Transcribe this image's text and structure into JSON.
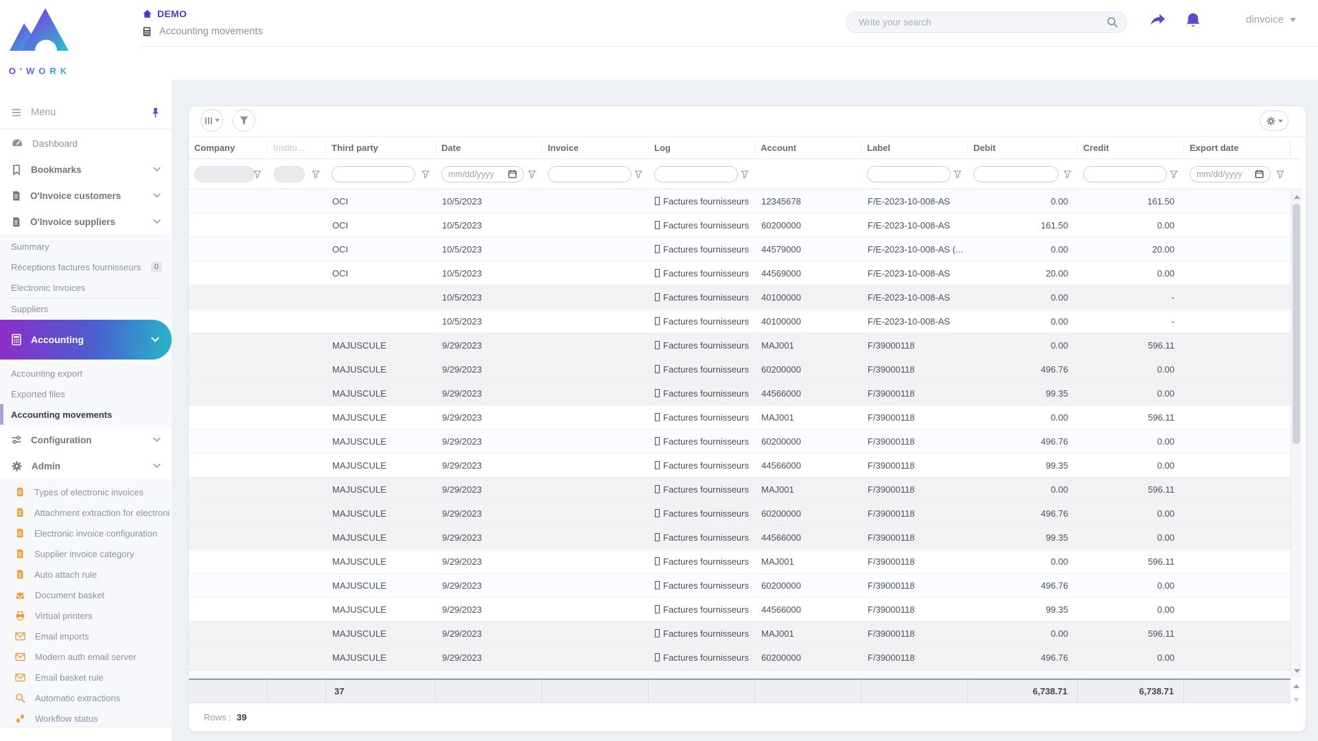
{
  "header": {
    "breadcrumb_root": "DEMO",
    "breadcrumb_page": "Accounting movements",
    "search_placeholder": "Write your search",
    "user": "dinvoice"
  },
  "sidebar": {
    "logo_text": "O'WORK",
    "menu_label": "Menu",
    "items": [
      {
        "label": "Dashboard"
      },
      {
        "label": "Bookmarks"
      },
      {
        "label": "O'Invoice customers"
      },
      {
        "label": "O'Invoice suppliers"
      }
    ],
    "suppliers_submenu": [
      {
        "label": "Summary"
      },
      {
        "label": "Réceptions factures fournisseurs",
        "badge": "0"
      },
      {
        "label": "Electronic Invoices"
      },
      {
        "label": "Suppliers"
      }
    ],
    "accounting_label": "Accounting",
    "accounting_submenu": [
      {
        "label": "Accounting export"
      },
      {
        "label": "Exported files"
      },
      {
        "label": "Accounting movements",
        "active": true
      }
    ],
    "configuration_label": "Configuration",
    "admin_label": "Admin",
    "admin_submenu": [
      {
        "label": "Types of electronic invoices"
      },
      {
        "label": "Attachment extraction for electroni"
      },
      {
        "label": "Electronic invoice configuration"
      },
      {
        "label": "Supplier invoice category"
      },
      {
        "label": "Auto attach rule"
      },
      {
        "label": "Document basket"
      },
      {
        "label": "Virtual printers"
      },
      {
        "label": "Email imports"
      },
      {
        "label": "Modern auth email server"
      },
      {
        "label": "Email basket rule"
      },
      {
        "label": "Automatic extractions"
      },
      {
        "label": "Workflow status"
      }
    ]
  },
  "grid": {
    "columns": [
      {
        "label": "Company"
      },
      {
        "label": "Institu..."
      },
      {
        "label": "Third party"
      },
      {
        "label": "Date"
      },
      {
        "label": "Invoice"
      },
      {
        "label": "Log"
      },
      {
        "label": "Account"
      },
      {
        "label": "Label"
      },
      {
        "label": "Debit"
      },
      {
        "label": "Credit"
      },
      {
        "label": "Export date"
      }
    ],
    "date_placeholder": "mm/dd/yyyy",
    "rows": [
      {
        "third_party": "OCI",
        "date": "10/5/2023",
        "log": "Factures fournisseurs",
        "account": "12345678",
        "label": "F/E-2023-10-008-AS",
        "debit": "0.00",
        "credit": "161.50",
        "shaded": false
      },
      {
        "third_party": "OCI",
        "date": "10/5/2023",
        "log": "Factures fournisseurs",
        "account": "60200000",
        "label": "F/E-2023-10-008-AS",
        "debit": "161.50",
        "credit": "0.00",
        "shaded": false
      },
      {
        "third_party": "OCI",
        "date": "10/5/2023",
        "log": "Factures fournisseurs",
        "account": "44579000",
        "label": "F/E-2023-10-008-AS (...",
        "debit": "0.00",
        "credit": "20.00",
        "shaded": false
      },
      {
        "third_party": "OCI",
        "date": "10/5/2023",
        "log": "Factures fournisseurs",
        "account": "44569000",
        "label": "F/E-2023-10-008-AS",
        "debit": "20.00",
        "credit": "0.00",
        "shaded": false
      },
      {
        "third_party": "",
        "date": "10/5/2023",
        "log": "Factures fournisseurs",
        "account": "40100000",
        "label": "F/E-2023-10-008-AS",
        "debit": "0.00",
        "credit": "-",
        "shaded": true
      },
      {
        "third_party": "",
        "date": "10/5/2023",
        "log": "Factures fournisseurs",
        "account": "40100000",
        "label": "F/E-2023-10-008-AS",
        "debit": "0.00",
        "credit": "-",
        "shaded": false
      },
      {
        "third_party": "MAJUSCULE",
        "date": "9/29/2023",
        "log": "Factures fournisseurs",
        "account": "MAJ001",
        "label": "F/39000118",
        "debit": "0.00",
        "credit": "596.11",
        "shaded": true
      },
      {
        "third_party": "MAJUSCULE",
        "date": "9/29/2023",
        "log": "Factures fournisseurs",
        "account": "60200000",
        "label": "F/39000118",
        "debit": "496.76",
        "credit": "0.00",
        "shaded": true
      },
      {
        "third_party": "MAJUSCULE",
        "date": "9/29/2023",
        "log": "Factures fournisseurs",
        "account": "44566000",
        "label": "F/39000118",
        "debit": "99.35",
        "credit": "0.00",
        "shaded": true
      },
      {
        "third_party": "MAJUSCULE",
        "date": "9/29/2023",
        "log": "Factures fournisseurs",
        "account": "MAJ001",
        "label": "F/39000118",
        "debit": "0.00",
        "credit": "596.11",
        "shaded": false
      },
      {
        "third_party": "MAJUSCULE",
        "date": "9/29/2023",
        "log": "Factures fournisseurs",
        "account": "60200000",
        "label": "F/39000118",
        "debit": "496.76",
        "credit": "0.00",
        "shaded": false
      },
      {
        "third_party": "MAJUSCULE",
        "date": "9/29/2023",
        "log": "Factures fournisseurs",
        "account": "44566000",
        "label": "F/39000118",
        "debit": "99.35",
        "credit": "0.00",
        "shaded": false
      },
      {
        "third_party": "MAJUSCULE",
        "date": "9/29/2023",
        "log": "Factures fournisseurs",
        "account": "MAJ001",
        "label": "F/39000118",
        "debit": "0.00",
        "credit": "596.11",
        "shaded": true
      },
      {
        "third_party": "MAJUSCULE",
        "date": "9/29/2023",
        "log": "Factures fournisseurs",
        "account": "60200000",
        "label": "F/39000118",
        "debit": "496.76",
        "credit": "0.00",
        "shaded": true
      },
      {
        "third_party": "MAJUSCULE",
        "date": "9/29/2023",
        "log": "Factures fournisseurs",
        "account": "44566000",
        "label": "F/39000118",
        "debit": "99.35",
        "credit": "0.00",
        "shaded": true
      },
      {
        "third_party": "MAJUSCULE",
        "date": "9/29/2023",
        "log": "Factures fournisseurs",
        "account": "MAJ001",
        "label": "F/39000118",
        "debit": "0.00",
        "credit": "596.11",
        "shaded": false
      },
      {
        "third_party": "MAJUSCULE",
        "date": "9/29/2023",
        "log": "Factures fournisseurs",
        "account": "60200000",
        "label": "F/39000118",
        "debit": "496.76",
        "credit": "0.00",
        "shaded": false
      },
      {
        "third_party": "MAJUSCULE",
        "date": "9/29/2023",
        "log": "Factures fournisseurs",
        "account": "44566000",
        "label": "F/39000118",
        "debit": "99.35",
        "credit": "0.00",
        "shaded": false
      },
      {
        "third_party": "MAJUSCULE",
        "date": "9/29/2023",
        "log": "Factures fournisseurs",
        "account": "MAJ001",
        "label": "F/39000118",
        "debit": "0.00",
        "credit": "596.11",
        "shaded": true
      },
      {
        "third_party": "MAJUSCULE",
        "date": "9/29/2023",
        "log": "Factures fournisseurs",
        "account": "60200000",
        "label": "F/39000118",
        "debit": "496.76",
        "credit": "0.00",
        "shaded": true
      }
    ],
    "totals": {
      "third_party_count": "37",
      "debit": "6,738.71",
      "credit": "6,738.71"
    },
    "footer": {
      "rows_label": "Rows :",
      "rows_count": "39"
    }
  }
}
